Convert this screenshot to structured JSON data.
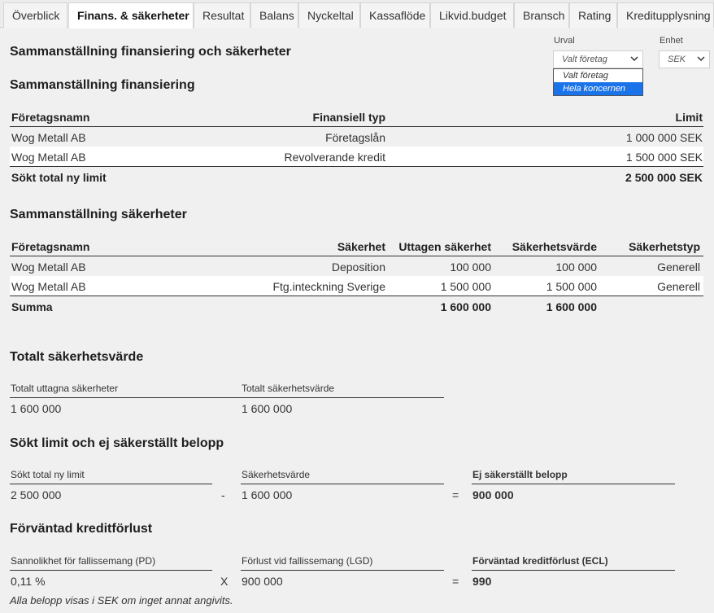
{
  "tabs": [
    {
      "label": "Överblick"
    },
    {
      "label": "Finans. & säkerheter"
    },
    {
      "label": "Resultat"
    },
    {
      "label": "Balans"
    },
    {
      "label": "Nyckeltal"
    },
    {
      "label": "Kassaflöde"
    },
    {
      "label": "Likvid.budget"
    },
    {
      "label": "Bransch"
    },
    {
      "label": "Rating"
    },
    {
      "label": "Kreditupplysning"
    }
  ],
  "page_title": "Sammanställning finansiering och säkerheter",
  "filters": {
    "urval_label": "Urval",
    "urval_value": "Valt företag",
    "urval_options": [
      "Valt företag",
      "Hela koncernen"
    ],
    "enhet_label": "Enhet",
    "enhet_value": "SEK"
  },
  "financing": {
    "title": "Sammanställning finansiering",
    "headers": [
      "Företagsnamn",
      "Finansiell typ",
      "Limit"
    ],
    "rows": [
      [
        "Wog Metall AB",
        "Företagslån",
        "1 000 000 SEK"
      ],
      [
        "Wog Metall AB",
        "Revolverande kredit",
        "1 500 000 SEK"
      ]
    ],
    "total_label": "Sökt total ny limit",
    "total_value": "2 500 000 SEK"
  },
  "collateral": {
    "title": "Sammanställning säkerheter",
    "headers": [
      "Företagsnamn",
      "Säkerhet",
      "Uttagen säkerhet",
      "Säkerhetsvärde",
      "Säkerhetstyp"
    ],
    "rows": [
      [
        "Wog Metall AB",
        "Deposition",
        "100 000",
        "100 000",
        "Generell"
      ],
      [
        "Wog Metall AB",
        "Ftg.inteckning Sverige",
        "1 500 000",
        "1 500 000",
        "Generell"
      ]
    ],
    "sum_label": "Summa",
    "sum_taken": "1 600 000",
    "sum_value": "1 600 000"
  },
  "total_collateral": {
    "title": "Totalt säkerhetsvärde",
    "taken_label": "Totalt uttagna säkerheter",
    "taken_value": "1 600 000",
    "value_label": "Totalt säkerhetsvärde",
    "value_value": "1 600 000"
  },
  "unsecured": {
    "title": "Sökt limit och ej säkerställt belopp",
    "limit_label": "Sökt total ny limit",
    "limit_value": "2 500 000",
    "minus": "-",
    "coll_label": "Säkerhetsvärde",
    "coll_value": "1 600 000",
    "equals": "=",
    "result_label": "Ej säkerställt belopp",
    "result_value": "900 000"
  },
  "ecl": {
    "title": "Förväntad kreditförlust",
    "pd_label": "Sannolikhet för fallissemang (PD)",
    "pd_value": "0,11 %",
    "times": "X",
    "lgd_label": "Förlust vid fallissemang (LGD)",
    "lgd_value": "900 000",
    "equals": "=",
    "result_label": "Förväntad kreditförlust (ECL)",
    "result_value": "990"
  },
  "footnote": "Alla belopp visas i SEK om inget annat angivits."
}
